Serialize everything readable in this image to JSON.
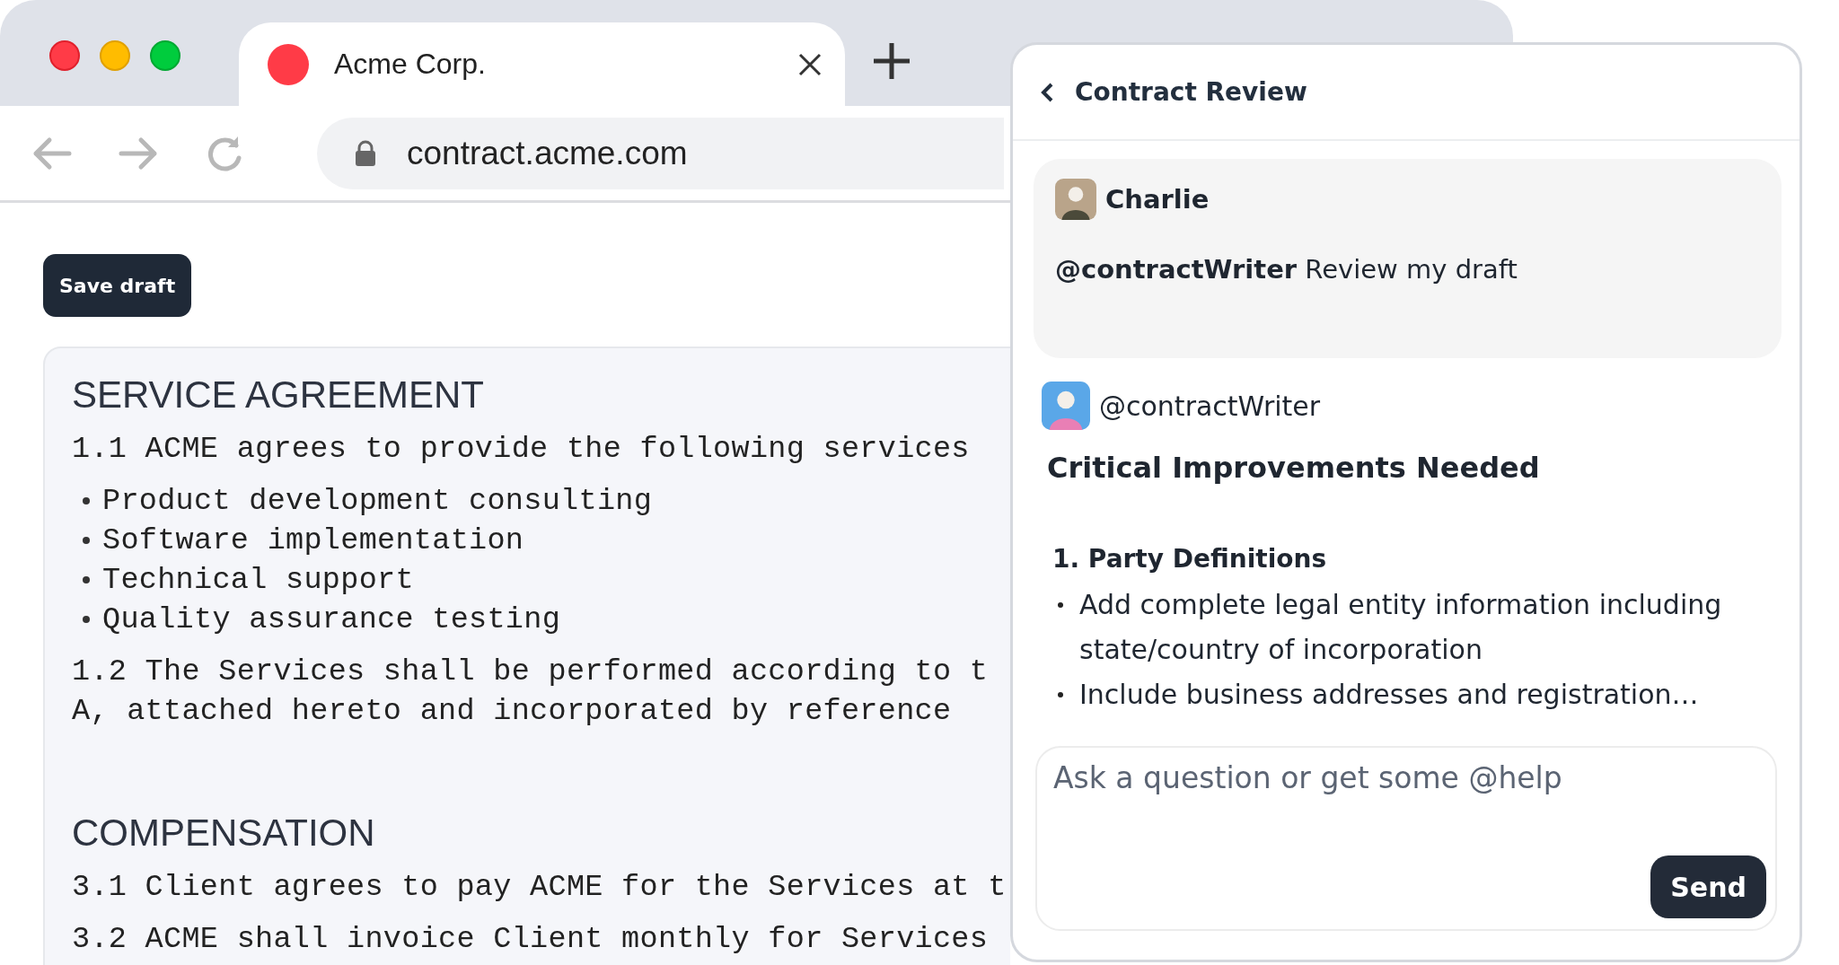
{
  "browser": {
    "tab": {
      "title": "Acme Corp."
    },
    "address_bar": {
      "url": "contract.acme.com"
    }
  },
  "page": {
    "save_button": "Save draft",
    "document": [
      {
        "heading": "SERVICE AGREEMENT",
        "blocks": [
          {
            "kind": "paragraph",
            "lines": [
              "1.1 ACME agrees to provide the following services"
            ]
          },
          {
            "kind": "bullets",
            "items": [
              "Product development consulting",
              "Software implementation",
              "Technical support",
              "Quality assurance testing"
            ]
          },
          {
            "kind": "paragraph",
            "lines": [
              "1.2 The Services shall be performed according to t",
              "A, attached hereto and incorporated by reference"
            ]
          }
        ]
      },
      {
        "heading": "COMPENSATION",
        "blocks": [
          {
            "kind": "paragraph",
            "lines": [
              "3.1 Client agrees to pay ACME for the Services at t"
            ]
          },
          {
            "kind": "paragraph",
            "lines": [
              "3.2 ACME shall invoice Client monthly for Services"
            ]
          }
        ]
      }
    ]
  },
  "chat": {
    "title": "Contract Review",
    "messages": [
      {
        "kind": "user",
        "author": "Charlie",
        "text": "**@contractWriter** Review my draft"
      },
      {
        "kind": "bot",
        "author": "@contractWriter",
        "heading": "Critical Improvements Needed",
        "sections": [
          {
            "title": "1. Party Definitions",
            "bullets": [
              "Add complete legal entity information including state/country of incorporation",
              "Include business addresses and registration…"
            ]
          }
        ]
      }
    ],
    "composer": {
      "placeholder": "Ask a question or get some @help",
      "send": "Send"
    }
  }
}
